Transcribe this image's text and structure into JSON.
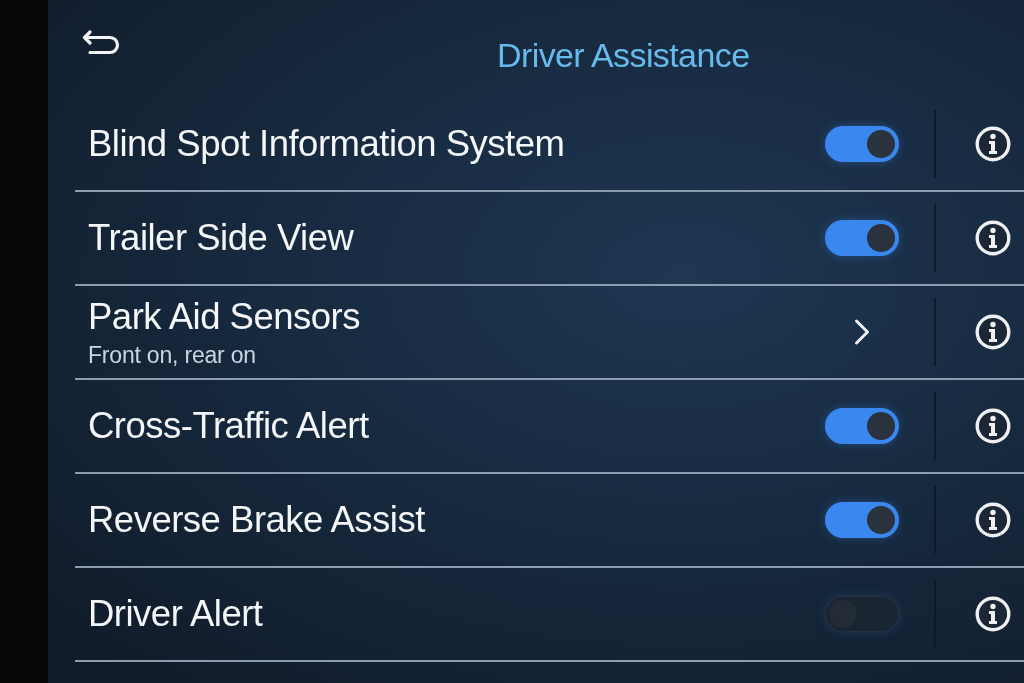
{
  "header": {
    "title": "Driver Assistance"
  },
  "rows": [
    {
      "kind": "toggle",
      "label": "Blind Spot Information System",
      "on": true
    },
    {
      "kind": "toggle",
      "label": "Trailer Side View",
      "on": true
    },
    {
      "kind": "submenu",
      "label": "Park Aid Sensors",
      "subtitle": "Front on, rear on"
    },
    {
      "kind": "toggle",
      "label": "Cross-Traffic Alert",
      "on": true
    },
    {
      "kind": "toggle",
      "label": "Reverse Brake Assist",
      "on": true
    },
    {
      "kind": "toggle",
      "label": "Driver Alert",
      "on": false
    }
  ]
}
